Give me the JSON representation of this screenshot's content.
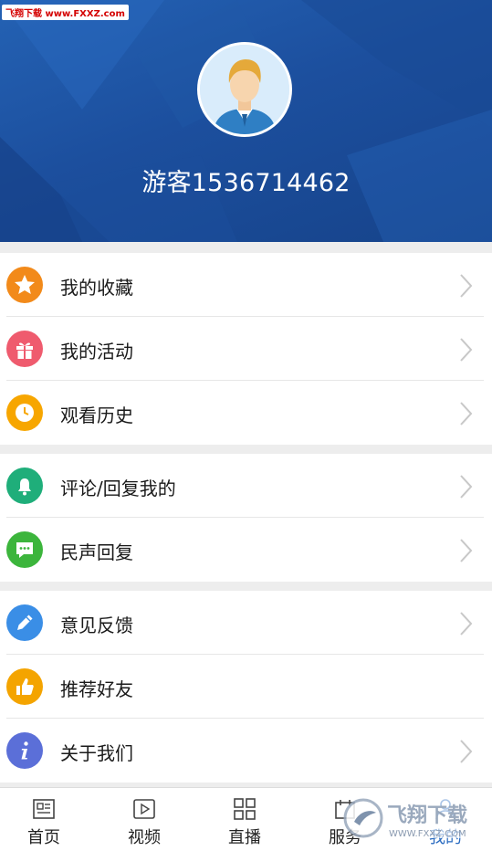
{
  "watermark": {
    "text": "飞翔下载 www.FXXZ.com"
  },
  "profile": {
    "username": "游客1536714462"
  },
  "menu": {
    "group1": [
      {
        "label": "我的收藏",
        "icon": "star-icon",
        "color": "#f28a1a"
      },
      {
        "label": "我的活动",
        "icon": "gift-icon",
        "color": "#ef5b6e"
      },
      {
        "label": "观看历史",
        "icon": "clock-icon",
        "color": "#f7a600"
      }
    ],
    "group2": [
      {
        "label": "评论/回复我的",
        "icon": "bell-icon",
        "color": "#1fae7a"
      },
      {
        "label": "民声回复",
        "icon": "chat-icon",
        "color": "#3cb53c"
      }
    ],
    "group3": [
      {
        "label": "意见反馈",
        "icon": "pencil-icon",
        "color": "#3a8ee6"
      },
      {
        "label": "推荐好友",
        "icon": "thumbs-up-icon",
        "color": "#f4a400"
      },
      {
        "label": "关于我们",
        "icon": "info-icon",
        "color": "#5b6fd8"
      }
    ]
  },
  "tabbar": {
    "tabs": [
      {
        "label": "首页",
        "icon": "news-icon"
      },
      {
        "label": "视频",
        "icon": "video-icon"
      },
      {
        "label": "直播",
        "icon": "grid-icon"
      },
      {
        "label": "服务",
        "icon": "service-icon"
      },
      {
        "label": "我的",
        "icon": "person-icon"
      }
    ]
  },
  "watermark_logo": {
    "title": "飞翔下载",
    "url": "WWW.FXXZ.COM"
  },
  "colors": {
    "header": "#1c4f9e",
    "chevron": "#c8c8c8",
    "separator": "#ededed"
  }
}
